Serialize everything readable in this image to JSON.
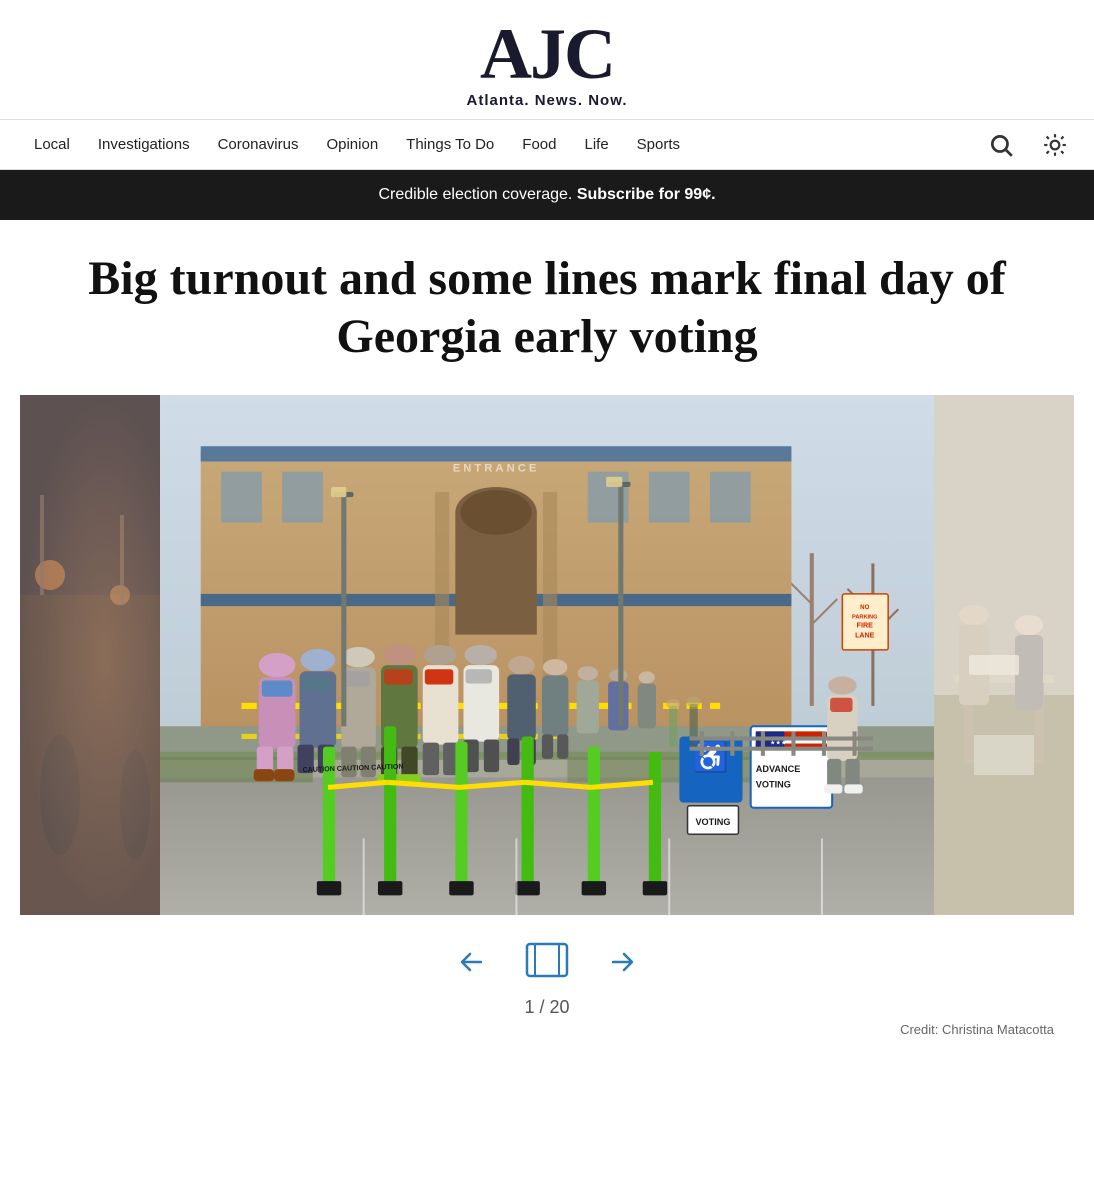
{
  "header": {
    "logo": "AJC",
    "tagline": "Atlanta. News. Now."
  },
  "nav": {
    "links": [
      {
        "label": "Local",
        "id": "local"
      },
      {
        "label": "Investigations",
        "id": "investigations"
      },
      {
        "label": "Coronavirus",
        "id": "coronavirus"
      },
      {
        "label": "Opinion",
        "id": "opinion"
      },
      {
        "label": "Things To Do",
        "id": "things-to-do"
      },
      {
        "label": "Food",
        "id": "food"
      },
      {
        "label": "Life",
        "id": "life"
      },
      {
        "label": "Sports",
        "id": "sports"
      }
    ]
  },
  "banner": {
    "text_normal": "Credible election coverage. ",
    "text_bold": "Subscribe for 99¢."
  },
  "article": {
    "title": "Big turnout and some lines mark final day of Georgia early voting"
  },
  "gallery": {
    "prev_label": "←",
    "next_label": "→",
    "current": 1,
    "total": 20,
    "counter_text": "1 / 20",
    "credit": "Credit: Christina Matacotta"
  },
  "signs": {
    "advance": "ADVANCE VOTING",
    "voting": "VOTING",
    "entrance": "ENTRANCE",
    "fire_lane": "FIRE LANE"
  }
}
